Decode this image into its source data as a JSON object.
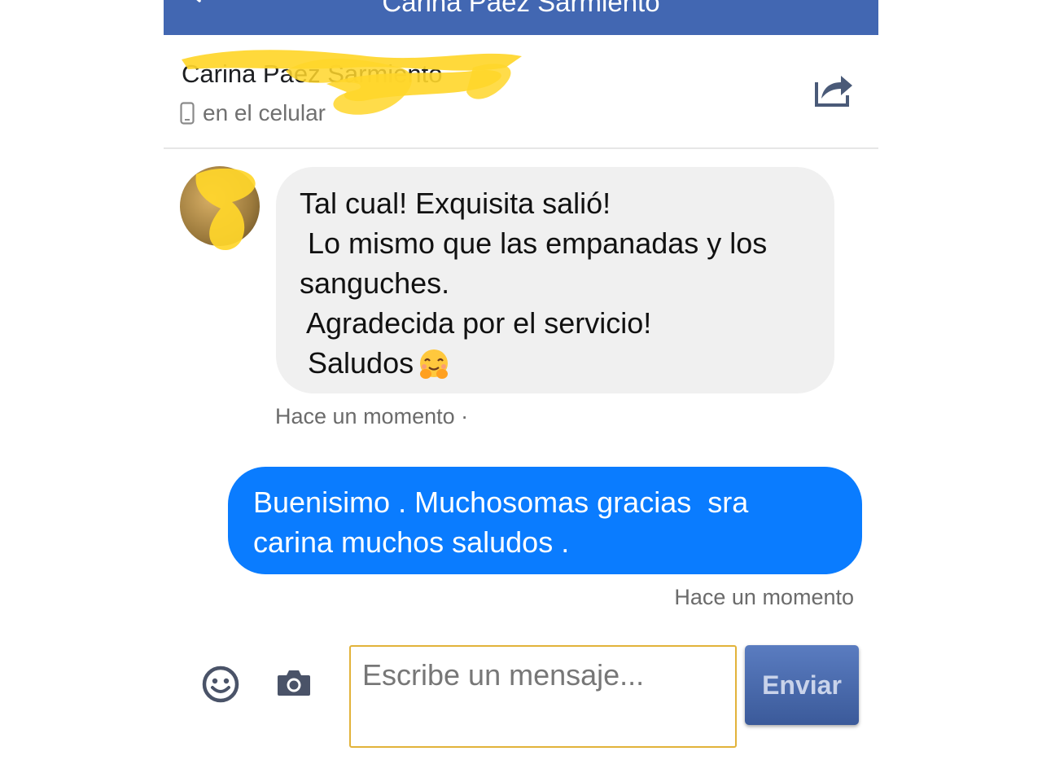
{
  "header": {
    "title": "Carina Paez Sarmiento"
  },
  "contact": {
    "name": "Carina Paez Sarmiento",
    "presence": "en el celular",
    "icons": {
      "presence": "mobile-phone-icon",
      "share": "share-icon"
    }
  },
  "messages": [
    {
      "from": "contact",
      "lines": [
        "Tal cual! Exquisita salió!",
        " Lo mismo que las empanadas y los",
        "sanguches.",
        " Agradecida por el servicio!",
        " Saludos"
      ],
      "emoji": "hugging-face-emoji",
      "time": "Hace un momento ·"
    },
    {
      "from": "me",
      "lines": [
        "Buenisimo . Muchosomas gracias  sra",
        "carina muchos saludos ."
      ],
      "time": "Hace un momento"
    }
  ],
  "composer": {
    "placeholder": "Escribe un mensaje...",
    "send_label": "Enviar",
    "icons": {
      "emoji": "smiley-icon",
      "camera": "camera-icon"
    }
  },
  "colors": {
    "header_bg": "#4267b2",
    "incoming_bubble": "#f0f0f0",
    "outgoing_bubble": "#0a7cff",
    "input_border": "#e2b33a",
    "redaction_marker": "#ffd62a"
  }
}
